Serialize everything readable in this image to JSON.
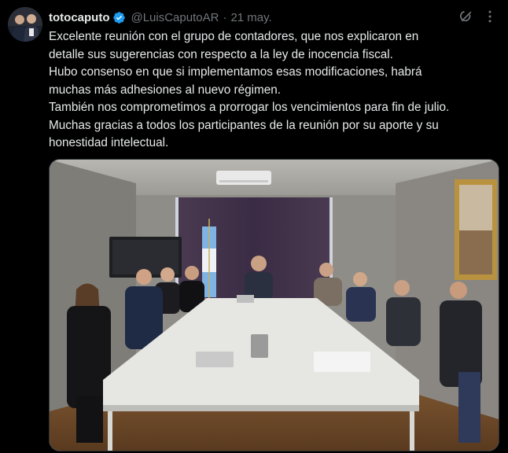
{
  "tweet": {
    "display_name": "totocaputo",
    "handle": "@LuisCaputoAR",
    "separator": "·",
    "date": "21 may.",
    "text_lines": [
      "Excelente reunión con el grupo de contadores, que nos explicaron en",
      "detalle sus sugerencias con respecto a la ley de inocencia fiscal.",
      "Hubo consenso en que si implementamos esas modificaciones, habrá",
      "muchas más adhesiones al nuevo régimen.",
      "También nos comprometimos a prorrogar los vencimientos para fin de julio.",
      "Muchas gracias a todos los participantes de la reunión por su aporte y su",
      "honestidad intelectual."
    ]
  },
  "icons": {
    "verified": "verified-badge-icon",
    "grok": "grok-icon",
    "more": "more-options-icon"
  },
  "colors": {
    "background": "#000000",
    "text": "#e7e9ea",
    "secondary_text": "#71767b",
    "verified_badge": "#1d9bf0",
    "border": "#2f3336"
  }
}
